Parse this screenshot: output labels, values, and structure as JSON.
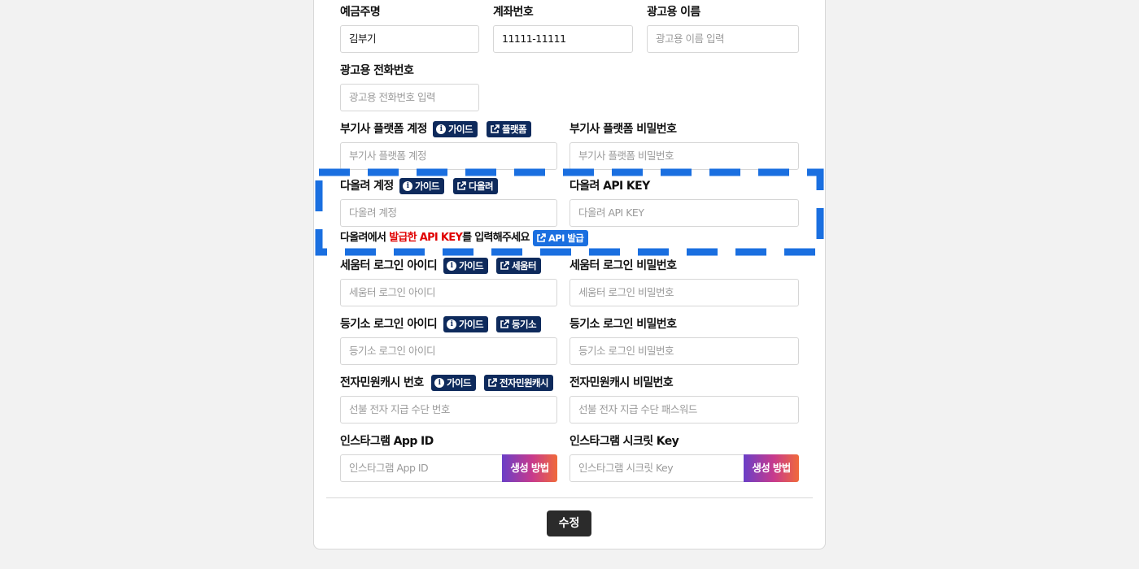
{
  "fields": {
    "depositor": {
      "label": "예금주명",
      "value": "김부기"
    },
    "account": {
      "label": "계좌번호",
      "value": "11111-11111"
    },
    "ad_name": {
      "label": "광고용 이름",
      "placeholder": "광고용 이름 입력"
    },
    "ad_phone": {
      "label": "광고용 전화번호",
      "placeholder": "광고용 전화번호 입력"
    },
    "bugisa_account": {
      "label": "부기사 플랫폼 계정",
      "placeholder": "부기사 플랫폼 계정"
    },
    "bugisa_password": {
      "label": "부기사 플랫폼 비밀번호",
      "placeholder": "부기사 플랫폼 비밀번호"
    },
    "dollyeo_account": {
      "label": "다올려 계정",
      "placeholder": "다올려 계정"
    },
    "dollyeo_api_key": {
      "label": "다올려 API KEY",
      "placeholder": "다올려 API KEY"
    },
    "semuter_id": {
      "label": "세움터 로그인 아이디",
      "placeholder": "세움터 로그인 아이디"
    },
    "semuter_password": {
      "label": "세움터 로그인 비밀번호",
      "placeholder": "세움터 로그인 비밀번호"
    },
    "registry_id": {
      "label": "등기소 로그인 아이디",
      "placeholder": "등기소 로그인 아이디"
    },
    "registry_password": {
      "label": "등기소 로그인 비밀번호",
      "placeholder": "등기소 로그인 비밀번호"
    },
    "ecash_number": {
      "label": "전자민원캐시 번호",
      "placeholder": "선불 전자 지급 수단 번호"
    },
    "ecash_password": {
      "label": "전자민원캐시 비밀번호",
      "placeholder": "선불 전자 지급 수단 패스워드"
    },
    "instagram_app_id": {
      "label": "인스타그램 App ID",
      "placeholder": "인스타그램 App ID"
    },
    "instagram_secret": {
      "label": "인스타그램 시크릿 Key",
      "placeholder": "인스타그램 시크릿 Key"
    }
  },
  "badges": {
    "guide": "가이드",
    "platform": "플랫폼",
    "dollyeo": "다올려",
    "semuter": "세움터",
    "registry": "등기소",
    "ecash": "전자민원캐시",
    "api_issue": "API 발급"
  },
  "note": {
    "prefix": "다올려에서 ",
    "highlight": "발급한 API KEY",
    "suffix": "를 입력해주세요"
  },
  "generate_label": "생성 방법",
  "submit_label": "수정",
  "colors": {
    "badge_navy": "#0e2a5c",
    "badge_blue": "#1a6fe0",
    "highlight_dash": "#1a6fe0",
    "note_red": "#e00000",
    "submit_bg": "#2b2b2b"
  },
  "icons": {
    "guide": "info-icon",
    "link": "external-link-icon"
  }
}
